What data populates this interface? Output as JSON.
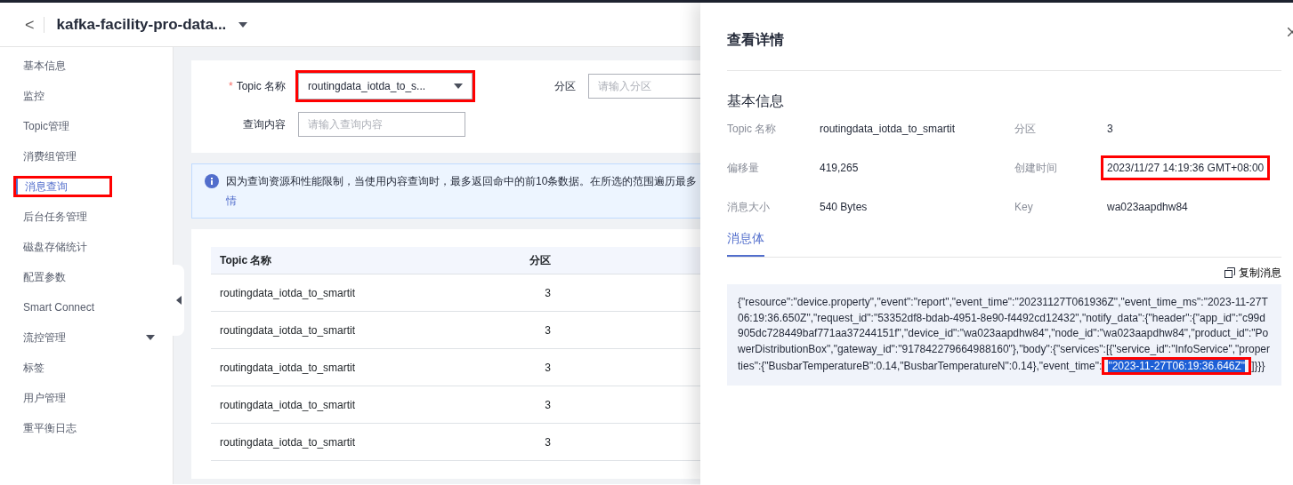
{
  "header": {
    "back": "<",
    "title": "kafka-facility-pro-data..."
  },
  "sidebar": {
    "items": [
      {
        "label": "基本信息",
        "selected": false,
        "highlighted": false,
        "expandable": false
      },
      {
        "label": "监控",
        "selected": false,
        "highlighted": false,
        "expandable": false
      },
      {
        "label": "Topic管理",
        "selected": false,
        "highlighted": false,
        "expandable": false
      },
      {
        "label": "消费组管理",
        "selected": false,
        "highlighted": false,
        "expandable": false
      },
      {
        "label": "消息查询",
        "selected": true,
        "highlighted": true,
        "expandable": false
      },
      {
        "label": "后台任务管理",
        "selected": false,
        "highlighted": false,
        "expandable": false
      },
      {
        "label": "磁盘存储统计",
        "selected": false,
        "highlighted": false,
        "expandable": false
      },
      {
        "label": "配置参数",
        "selected": false,
        "highlighted": false,
        "expandable": false
      },
      {
        "label": "Smart Connect",
        "selected": false,
        "highlighted": false,
        "expandable": false
      },
      {
        "label": "流控管理",
        "selected": false,
        "highlighted": false,
        "expandable": true
      },
      {
        "label": "标签",
        "selected": false,
        "highlighted": false,
        "expandable": false
      },
      {
        "label": "用户管理",
        "selected": false,
        "highlighted": false,
        "expandable": false
      },
      {
        "label": "重平衡日志",
        "selected": false,
        "highlighted": false,
        "expandable": false
      }
    ]
  },
  "filters": {
    "topic": {
      "required_mark": "*",
      "label": "Topic 名称",
      "value": "routingdata_iotda_to_s...",
      "highlighted": true
    },
    "partition": {
      "label": "分区",
      "placeholder": "请输入分区"
    },
    "content": {
      "label": "查询内容",
      "placeholder": "请输入查询内容"
    }
  },
  "notice": {
    "text": "因为查询资源和性能限制，当使用内容查询时，最多返回命中的前10条数据。在所选的范围遍历最多",
    "link": "情"
  },
  "table": {
    "columns": [
      "Topic 名称",
      "分区"
    ],
    "rows": [
      [
        "routingdata_iotda_to_smartit",
        "3"
      ],
      [
        "routingdata_iotda_to_smartit",
        "3"
      ],
      [
        "routingdata_iotda_to_smartit",
        "3"
      ],
      [
        "routingdata_iotda_to_smartit",
        "3"
      ],
      [
        "routingdata_iotda_to_smartit",
        "3"
      ]
    ]
  },
  "drawer": {
    "title": "查看详情",
    "section": "基本信息",
    "fields": [
      {
        "label": "Topic 名称",
        "value": "routingdata_iotda_to_smartit",
        "highlighted": false
      },
      {
        "label": "分区",
        "value": "3",
        "highlighted": false
      },
      {
        "label": "偏移量",
        "value": "419,265",
        "highlighted": false
      },
      {
        "label": "创建时间",
        "value": "2023/11/27 14:19:36 GMT+08:00",
        "highlighted": true
      },
      {
        "label": "消息大小",
        "value": "540 Bytes",
        "highlighted": false
      },
      {
        "label": "Key",
        "value": "wa023aapdhw84",
        "highlighted": false
      }
    ],
    "tabs": [
      {
        "label": "消息体",
        "selected": true
      }
    ],
    "copy": "复制消息",
    "body": {
      "before": "{\"resource\":\"device.property\",\"event\":\"report\",\"event_time\":\"20231127T061936Z\",\"event_time_ms\":\"2023-11-27T06:19:36.650Z\",\"request_id\":\"53352df8-bdab-4951-8e90-f4492cd12432\",\"notify_data\":{\"header\":{\"app_id\":\"c99d905dc728449baf771aa37244151f\",\"device_id\":\"wa023aapdhw84\",\"node_id\":\"wa023aapdhw84\",\"product_id\":\"PowerDistributionBox\",\"gateway_id\":\"917842279664988160\"},\"body\":{\"services\":[{\"service_id\":\"InfoService\",\"properties\":{\"BusbarTemperatureB\":0.14,\"BusbarTemperatureN\":0.14},\"event_time\":",
      "selection": "\"2023-11-27T06:19:36.646Z\"",
      "after": "]}}}"
    }
  }
}
